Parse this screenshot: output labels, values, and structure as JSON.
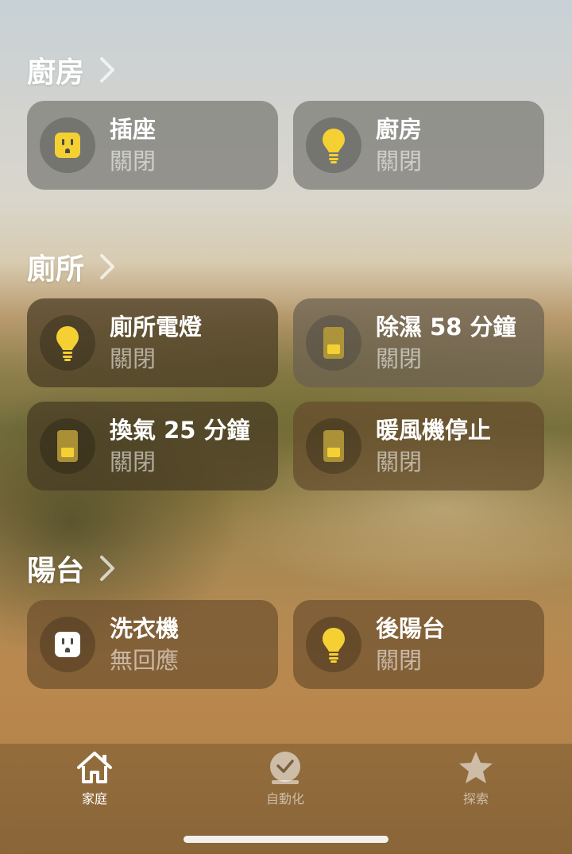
{
  "sections": [
    {
      "title": "廚房",
      "tiles": [
        {
          "name": "插座",
          "status": "關閉",
          "icon": "outlet-icon",
          "icon_color": "#f5d033"
        },
        {
          "name": "廚房",
          "status": "關閉",
          "icon": "lightbulb-icon",
          "icon_color": "#f5d033"
        }
      ]
    },
    {
      "title": "廁所",
      "tiles": [
        {
          "name": "廁所電燈",
          "status": "關閉",
          "icon": "lightbulb-icon",
          "icon_color": "#f5d033"
        },
        {
          "name": "除濕 58 分鐘",
          "status": "關閉",
          "icon": "switch-icon",
          "icon_color": "#d8b13a"
        },
        {
          "name": "換氣 25 分鐘",
          "status": "關閉",
          "icon": "switch-icon",
          "icon_color": "#d8b13a"
        },
        {
          "name": "暖風機停止",
          "status": "關閉",
          "icon": "switch-icon",
          "icon_color": "#d8b13a"
        }
      ]
    },
    {
      "title": "陽台",
      "tiles": [
        {
          "name": "洗衣機",
          "status": "無回應",
          "icon": "outlet-icon",
          "icon_color": "#ffffff"
        },
        {
          "name": "後陽台",
          "status": "關閉",
          "icon": "lightbulb-icon",
          "icon_color": "#f5d033"
        }
      ]
    }
  ],
  "tabbar": {
    "tabs": [
      {
        "label": "家庭",
        "icon": "home-icon",
        "active": true
      },
      {
        "label": "自動化",
        "icon": "clock-check-icon",
        "active": false
      },
      {
        "label": "探索",
        "icon": "star-icon",
        "active": false
      }
    ]
  }
}
